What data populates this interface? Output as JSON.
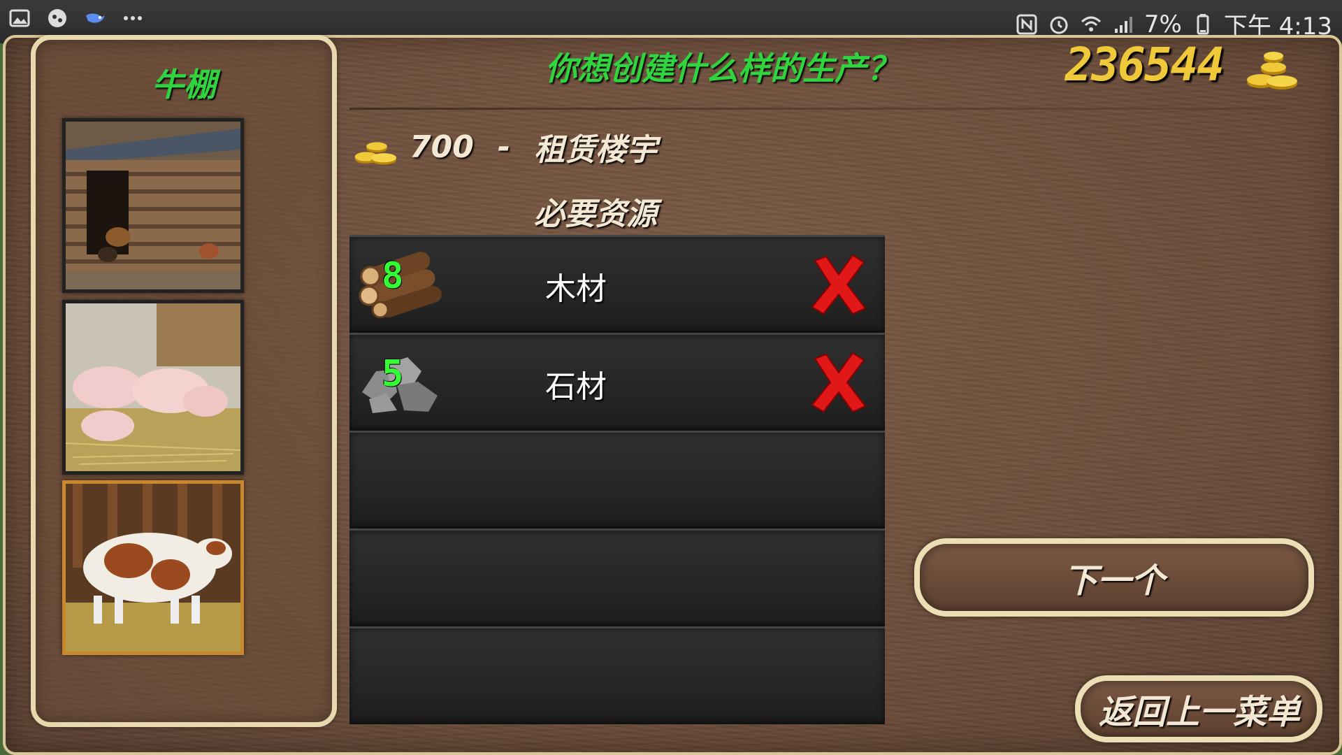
{
  "status_bar": {
    "left_icons": [
      "gallery-icon",
      "game-controller-icon",
      "bird-app-icon",
      "more-dots-icon"
    ],
    "right_icons": [
      "nfc-icon",
      "alarm-icon",
      "wifi-icon",
      "signal-icon"
    ],
    "battery": "7%",
    "time": "下午 4:13"
  },
  "sidebar": {
    "title": "牛棚",
    "thumbnails": [
      {
        "name": "chicken-coop",
        "selected": false
      },
      {
        "name": "pig-pen",
        "selected": false
      },
      {
        "name": "cow-barn",
        "selected": true
      }
    ]
  },
  "header": {
    "question": "你想创建什么样的生产？",
    "money": "236544"
  },
  "cost": {
    "amount": "700",
    "separator": "-",
    "label": "租赁楼宇"
  },
  "requirements": {
    "title": "必要资源",
    "rows": [
      {
        "count": "8",
        "name": "木材",
        "icon": "wood-logs-icon",
        "status_icon": "red-x-icon"
      },
      {
        "count": "5",
        "name": "石材",
        "icon": "stones-icon",
        "status_icon": "red-x-icon"
      },
      {
        "count": "",
        "name": ""
      },
      {
        "count": "",
        "name": ""
      },
      {
        "count": "",
        "name": ""
      }
    ]
  },
  "buttons": {
    "next": "下一个",
    "back": "返回上一菜单"
  },
  "colors": {
    "accent_green": "#2fd43f",
    "money_gold": "#f0c93a",
    "count_green": "#34ff34",
    "error_red": "#e01818"
  }
}
